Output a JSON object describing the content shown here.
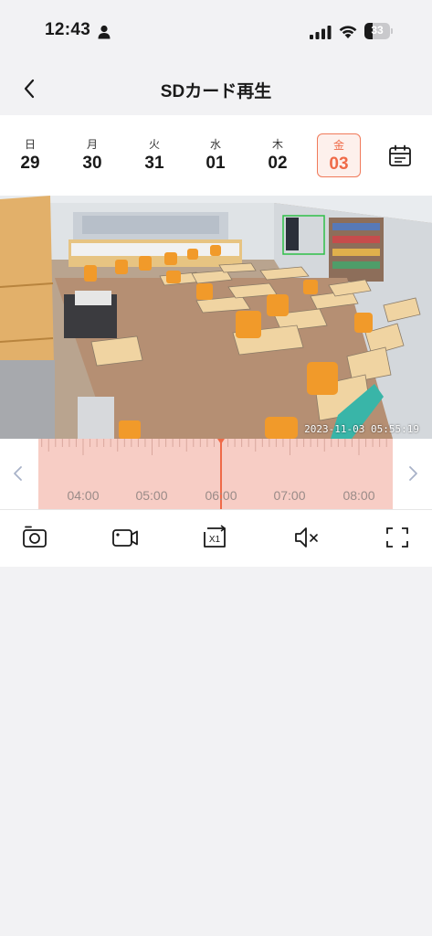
{
  "status_bar": {
    "time": "12:43",
    "battery_level": "33",
    "icons": [
      "person-icon",
      "signal-icon",
      "wifi-icon",
      "battery-icon"
    ]
  },
  "nav": {
    "title": "SDカード再生",
    "back_icon": "chevron-left-icon"
  },
  "dates": [
    {
      "weekday": "日",
      "day": "29"
    },
    {
      "weekday": "月",
      "day": "30"
    },
    {
      "weekday": "火",
      "day": "31"
    },
    {
      "weekday": "水",
      "day": "01"
    },
    {
      "weekday": "木",
      "day": "02"
    },
    {
      "weekday": "金",
      "day": "03"
    }
  ],
  "selected_date_index": 5,
  "calendar_icon": "calendar-icon",
  "camera": {
    "timestamp": "2023-11-03 05:55:19"
  },
  "timeline": {
    "labels": [
      "04:00",
      "05:00",
      "06:00",
      "07:00",
      "08:00"
    ],
    "cursor_time": "06:00",
    "prev_icon": "chevron-left-icon",
    "next_icon": "chevron-right-icon"
  },
  "controls": {
    "speed_label": "X1",
    "icons": [
      "camera-icon",
      "video-record-icon",
      "playback-speed-icon",
      "mute-icon",
      "fullscreen-icon"
    ]
  },
  "colors": {
    "accent": "#ef6a48",
    "timeline_fill": "#f7cdc5",
    "selected_bg": "#fdf0ec"
  }
}
